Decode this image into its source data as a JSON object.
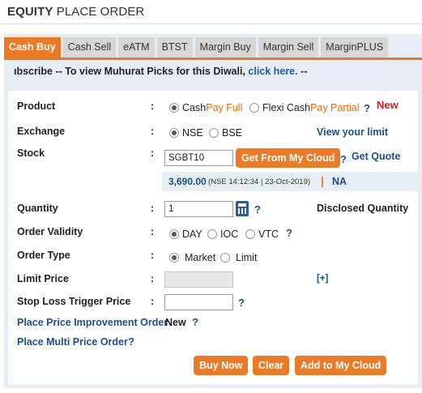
{
  "header": {
    "title_bold": "EQUITY",
    "title_rest": " PLACE ORDER"
  },
  "tabs": [
    {
      "label": "Cash Buy",
      "active": true
    },
    {
      "label": "Cash Sell",
      "active": false
    },
    {
      "label": "eATM",
      "active": false
    },
    {
      "label": "BTST",
      "active": false
    },
    {
      "label": "Margin Buy",
      "active": false
    },
    {
      "label": "Margin Sell",
      "active": false
    },
    {
      "label": "MarginPLUS",
      "active": false
    }
  ],
  "ticker": {
    "text": "ıbscribe -- To view Muhurat Picks for this Diwali, ",
    "link": "click here.",
    "tail": " --"
  },
  "product": {
    "label": "Product",
    "opt1_a": "Cash ",
    "opt1_b": "Pay Full",
    "opt2_a": "Flexi Cash ",
    "opt2_b": "Pay Partial",
    "help": "?",
    "new_badge": "New"
  },
  "exchange": {
    "label": "Exchange",
    "opt1": "NSE",
    "opt2": "BSE",
    "link": "View your limit"
  },
  "stock": {
    "label": "Stock",
    "value": "SGBT10",
    "button": "Get From My Cloud",
    "help": "?",
    "quote_link": "Get Quote"
  },
  "quote": {
    "price": "3,690.00",
    "meta": "(NSE 14:12:34 | 23-Oct-2019)",
    "sep": "|",
    "change": "NA"
  },
  "quantity": {
    "label": "Quantity",
    "value": "1",
    "help": "?",
    "disclosed": "Disclosed Quantity"
  },
  "validity": {
    "label": "Order Validity",
    "opt1": "DAY",
    "opt2": "IOC",
    "opt3": "VTC",
    "help": "?"
  },
  "order_type": {
    "label": "Order Type",
    "opt1": "Market",
    "opt2": "Limit"
  },
  "limit_price": {
    "label": "Limit Price",
    "expand": "[+]"
  },
  "stop_loss": {
    "label": "Stop Loss Trigger Price",
    "help": "?"
  },
  "price_improvement": {
    "label": "Place Price Improvement Order",
    "new_badge": "New",
    "help": "?"
  },
  "multi_price": {
    "label": "Place Multi Price Order",
    "help": "?"
  },
  "actions": {
    "buy": "Buy Now",
    "clear": "Clear",
    "add_cloud": "Add to My Cloud"
  },
  "colon": ":",
  "colors": {
    "accent": "#ec7a24",
    "link": "#1a4f8b",
    "new": "#d21f1f"
  }
}
